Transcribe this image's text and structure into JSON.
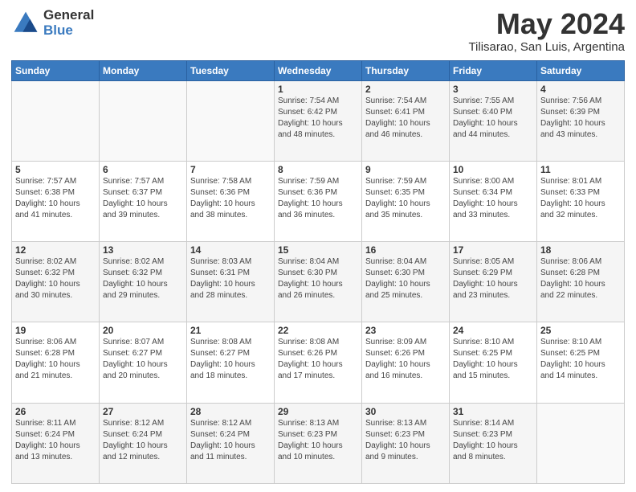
{
  "header": {
    "logo_general": "General",
    "logo_blue": "Blue",
    "main_title": "May 2024",
    "subtitle": "Tilisarao, San Luis, Argentina"
  },
  "days_of_week": [
    "Sunday",
    "Monday",
    "Tuesday",
    "Wednesday",
    "Thursday",
    "Friday",
    "Saturday"
  ],
  "weeks": [
    [
      {
        "day": "",
        "info": ""
      },
      {
        "day": "",
        "info": ""
      },
      {
        "day": "",
        "info": ""
      },
      {
        "day": "1",
        "info": "Sunrise: 7:54 AM\nSunset: 6:42 PM\nDaylight: 10 hours\nand 48 minutes."
      },
      {
        "day": "2",
        "info": "Sunrise: 7:54 AM\nSunset: 6:41 PM\nDaylight: 10 hours\nand 46 minutes."
      },
      {
        "day": "3",
        "info": "Sunrise: 7:55 AM\nSunset: 6:40 PM\nDaylight: 10 hours\nand 44 minutes."
      },
      {
        "day": "4",
        "info": "Sunrise: 7:56 AM\nSunset: 6:39 PM\nDaylight: 10 hours\nand 43 minutes."
      }
    ],
    [
      {
        "day": "5",
        "info": "Sunrise: 7:57 AM\nSunset: 6:38 PM\nDaylight: 10 hours\nand 41 minutes."
      },
      {
        "day": "6",
        "info": "Sunrise: 7:57 AM\nSunset: 6:37 PM\nDaylight: 10 hours\nand 39 minutes."
      },
      {
        "day": "7",
        "info": "Sunrise: 7:58 AM\nSunset: 6:36 PM\nDaylight: 10 hours\nand 38 minutes."
      },
      {
        "day": "8",
        "info": "Sunrise: 7:59 AM\nSunset: 6:36 PM\nDaylight: 10 hours\nand 36 minutes."
      },
      {
        "day": "9",
        "info": "Sunrise: 7:59 AM\nSunset: 6:35 PM\nDaylight: 10 hours\nand 35 minutes."
      },
      {
        "day": "10",
        "info": "Sunrise: 8:00 AM\nSunset: 6:34 PM\nDaylight: 10 hours\nand 33 minutes."
      },
      {
        "day": "11",
        "info": "Sunrise: 8:01 AM\nSunset: 6:33 PM\nDaylight: 10 hours\nand 32 minutes."
      }
    ],
    [
      {
        "day": "12",
        "info": "Sunrise: 8:02 AM\nSunset: 6:32 PM\nDaylight: 10 hours\nand 30 minutes."
      },
      {
        "day": "13",
        "info": "Sunrise: 8:02 AM\nSunset: 6:32 PM\nDaylight: 10 hours\nand 29 minutes."
      },
      {
        "day": "14",
        "info": "Sunrise: 8:03 AM\nSunset: 6:31 PM\nDaylight: 10 hours\nand 28 minutes."
      },
      {
        "day": "15",
        "info": "Sunrise: 8:04 AM\nSunset: 6:30 PM\nDaylight: 10 hours\nand 26 minutes."
      },
      {
        "day": "16",
        "info": "Sunrise: 8:04 AM\nSunset: 6:30 PM\nDaylight: 10 hours\nand 25 minutes."
      },
      {
        "day": "17",
        "info": "Sunrise: 8:05 AM\nSunset: 6:29 PM\nDaylight: 10 hours\nand 23 minutes."
      },
      {
        "day": "18",
        "info": "Sunrise: 8:06 AM\nSunset: 6:28 PM\nDaylight: 10 hours\nand 22 minutes."
      }
    ],
    [
      {
        "day": "19",
        "info": "Sunrise: 8:06 AM\nSunset: 6:28 PM\nDaylight: 10 hours\nand 21 minutes."
      },
      {
        "day": "20",
        "info": "Sunrise: 8:07 AM\nSunset: 6:27 PM\nDaylight: 10 hours\nand 20 minutes."
      },
      {
        "day": "21",
        "info": "Sunrise: 8:08 AM\nSunset: 6:27 PM\nDaylight: 10 hours\nand 18 minutes."
      },
      {
        "day": "22",
        "info": "Sunrise: 8:08 AM\nSunset: 6:26 PM\nDaylight: 10 hours\nand 17 minutes."
      },
      {
        "day": "23",
        "info": "Sunrise: 8:09 AM\nSunset: 6:26 PM\nDaylight: 10 hours\nand 16 minutes."
      },
      {
        "day": "24",
        "info": "Sunrise: 8:10 AM\nSunset: 6:25 PM\nDaylight: 10 hours\nand 15 minutes."
      },
      {
        "day": "25",
        "info": "Sunrise: 8:10 AM\nSunset: 6:25 PM\nDaylight: 10 hours\nand 14 minutes."
      }
    ],
    [
      {
        "day": "26",
        "info": "Sunrise: 8:11 AM\nSunset: 6:24 PM\nDaylight: 10 hours\nand 13 minutes."
      },
      {
        "day": "27",
        "info": "Sunrise: 8:12 AM\nSunset: 6:24 PM\nDaylight: 10 hours\nand 12 minutes."
      },
      {
        "day": "28",
        "info": "Sunrise: 8:12 AM\nSunset: 6:24 PM\nDaylight: 10 hours\nand 11 minutes."
      },
      {
        "day": "29",
        "info": "Sunrise: 8:13 AM\nSunset: 6:23 PM\nDaylight: 10 hours\nand 10 minutes."
      },
      {
        "day": "30",
        "info": "Sunrise: 8:13 AM\nSunset: 6:23 PM\nDaylight: 10 hours\nand 9 minutes."
      },
      {
        "day": "31",
        "info": "Sunrise: 8:14 AM\nSunset: 6:23 PM\nDaylight: 10 hours\nand 8 minutes."
      },
      {
        "day": "",
        "info": ""
      }
    ]
  ]
}
